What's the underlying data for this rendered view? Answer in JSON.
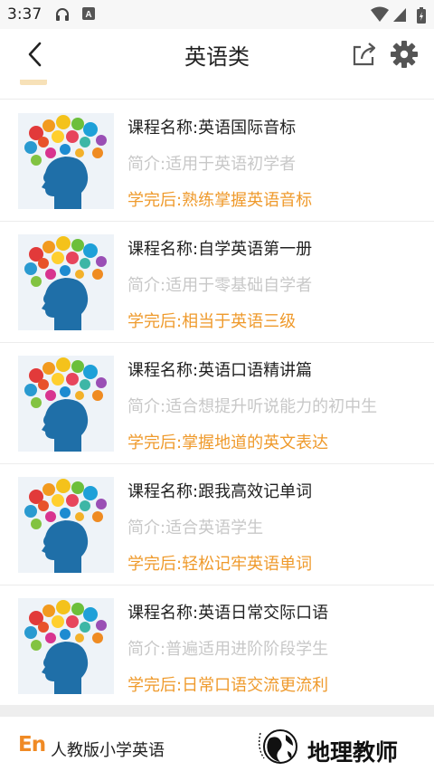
{
  "status_bar": {
    "time": "3:37",
    "icons": [
      "headphones-icon",
      "app-a-icon",
      "wifi-icon",
      "signal-icon",
      "battery-icon"
    ]
  },
  "header": {
    "title": "英语类",
    "icons": [
      "back-arrow-icon",
      "share-icon",
      "gear-icon"
    ]
  },
  "courses": [
    {
      "name": "课程名称:英语国际音标",
      "intro": "简介:适用于英语初学者",
      "after": "学完后:熟练掌握英语音标"
    },
    {
      "name": "课程名称:自学英语第一册",
      "intro": "简介:适用于零基础自学者",
      "after": "学完后:相当于英语三级"
    },
    {
      "name": "课程名称:英语口语精讲篇",
      "intro": "简介:适合想提升听说能力的初中生",
      "after": "学完后:掌握地道的英文表达"
    },
    {
      "name": "课程名称:跟我高效记单词",
      "intro": "简介:适合英语学生",
      "after": "学完后:轻松记牢英语单词"
    },
    {
      "name": "课程名称:英语日常交际口语",
      "intro": "简介:普遍适用进阶阶段学生",
      "after": "学完后:日常口语交流更流利"
    }
  ],
  "footer": {
    "logo_text": "En",
    "app_name": "人教版小学英语",
    "brand": "地理教师"
  },
  "colors": {
    "accent": "#ef9a2c",
    "muted": "#c8c8c8",
    "text": "#222222",
    "head_blue": "#1f6fa8"
  }
}
